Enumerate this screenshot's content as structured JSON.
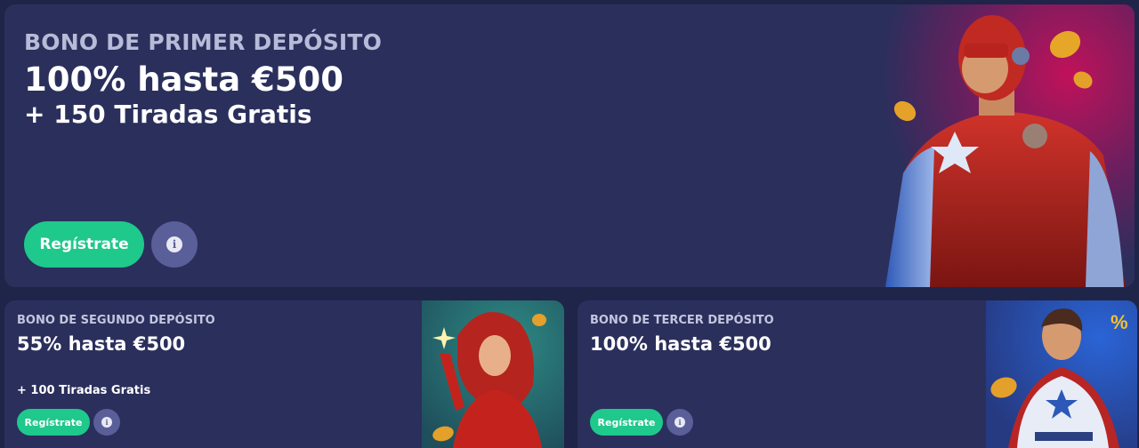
{
  "hero": {
    "kicker": "BONO DE PRIMER DEPÓSITO",
    "headline": "100% hasta €500",
    "sub": "+ 150 Tiradas Gratis",
    "register_label": "Regístrate",
    "info_icon": "info-icon"
  },
  "second": {
    "kicker": "BONO DE SEGUNDO DEPÓSITO",
    "title": "55% hasta €500",
    "sub": "+ 100 Tiradas Gratis",
    "register_label": "Regístrate",
    "info_icon": "info-icon"
  },
  "third": {
    "kicker": "BONO DE TERCER DEPÓSITO",
    "title": "100% hasta €500",
    "register_label": "Regístrate",
    "info_icon": "info-icon",
    "badge": "%"
  },
  "colors": {
    "page_bg": "#1f2449",
    "card_bg": "#2b2f5c",
    "accent_green": "#1fc88b",
    "info_btn": "#5a5e99"
  }
}
